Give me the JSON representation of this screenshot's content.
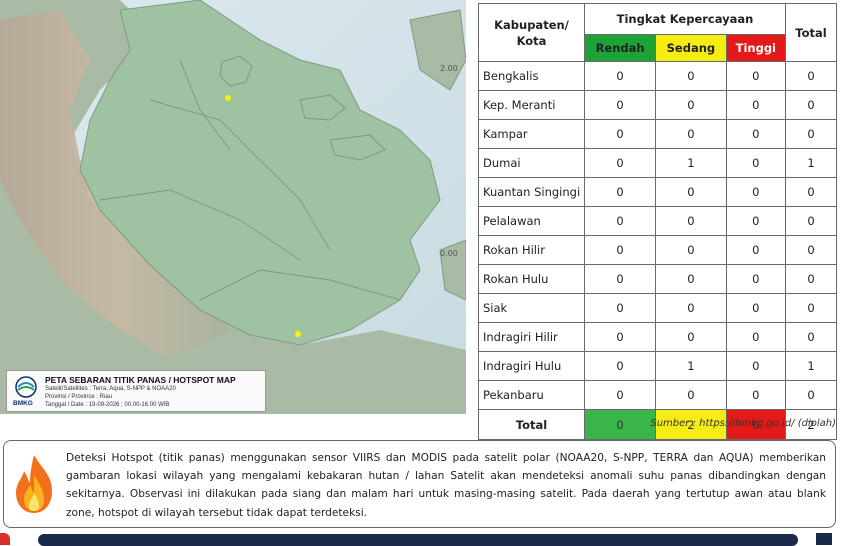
{
  "map": {
    "lat_labels": [
      "2.00",
      "0.00"
    ],
    "legend": {
      "title": "PETA SEBARAN TITIK PANAS / HOTSPOT MAP",
      "satellite": "Satelit/Satellites : Terra, Aqua, S-NPP & NOAA20",
      "province": "Provinsi / Province : Riau",
      "date": "Tanggal / Date : 19-09-2026 ; 00.00-16.00 WIB",
      "logo_text": "BMKG"
    },
    "hotspot_color": "#f5f500"
  },
  "table": {
    "header": {
      "region": "Kabupaten/ Kota",
      "confidence": "Tingkat Kepercayaan",
      "low": "Rendah",
      "medium": "Sedang",
      "high": "Tinggi",
      "total": "Total"
    },
    "rows": [
      {
        "name": "Bengkalis",
        "low": "0",
        "medium": "0",
        "high": "0",
        "total": "0"
      },
      {
        "name": "Kep. Meranti",
        "low": "0",
        "medium": "0",
        "high": "0",
        "total": "0"
      },
      {
        "name": "Kampar",
        "low": "0",
        "medium": "0",
        "high": "0",
        "total": "0"
      },
      {
        "name": "Dumai",
        "low": "0",
        "medium": "1",
        "high": "0",
        "total": "1"
      },
      {
        "name": "Kuantan Singingi",
        "low": "0",
        "medium": "0",
        "high": "0",
        "total": "0"
      },
      {
        "name": "Pelalawan",
        "low": "0",
        "medium": "0",
        "high": "0",
        "total": "0"
      },
      {
        "name": "Rokan Hilir",
        "low": "0",
        "medium": "0",
        "high": "0",
        "total": "0"
      },
      {
        "name": "Rokan Hulu",
        "low": "0",
        "medium": "0",
        "high": "0",
        "total": "0"
      },
      {
        "name": "Siak",
        "low": "0",
        "medium": "0",
        "high": "0",
        "total": "0"
      },
      {
        "name": "Indragiri Hilir",
        "low": "0",
        "medium": "0",
        "high": "0",
        "total": "0"
      },
      {
        "name": "Indragiri Hulu",
        "low": "0",
        "medium": "1",
        "high": "0",
        "total": "1"
      },
      {
        "name": "Pekanbaru",
        "low": "0",
        "medium": "0",
        "high": "0",
        "total": "0"
      }
    ],
    "totals": {
      "label": "Total",
      "low": "0",
      "medium": "2",
      "high": "0",
      "total": "2"
    },
    "colors": {
      "low": "#1ea338",
      "medium": "#f5ec14",
      "high": "#e31a18"
    }
  },
  "source": "Sumber : https://bmkg.go.id/ (diolah)",
  "note": "Deteksi Hotspot (titik panas) menggunakan sensor VIIRS dan MODIS pada satelit polar (NOAA20, S-NPP, TERRA dan AQUA) memberikan gambaran lokasi wilayah yang mengalami kebakaran hutan / lahan Satelit akan mendeteksi anomali suhu panas dibandingkan dengan sekitarnya. Observasi ini dilakukan pada siang dan malam hari untuk masing-masing satelit. Pada daerah yang tertutup awan atau blank zone, hotspot di wilayah tersebut tidak dapat terdeteksi.",
  "icons": {
    "flame": "flame-icon",
    "logo": "bmkg-logo-icon"
  }
}
